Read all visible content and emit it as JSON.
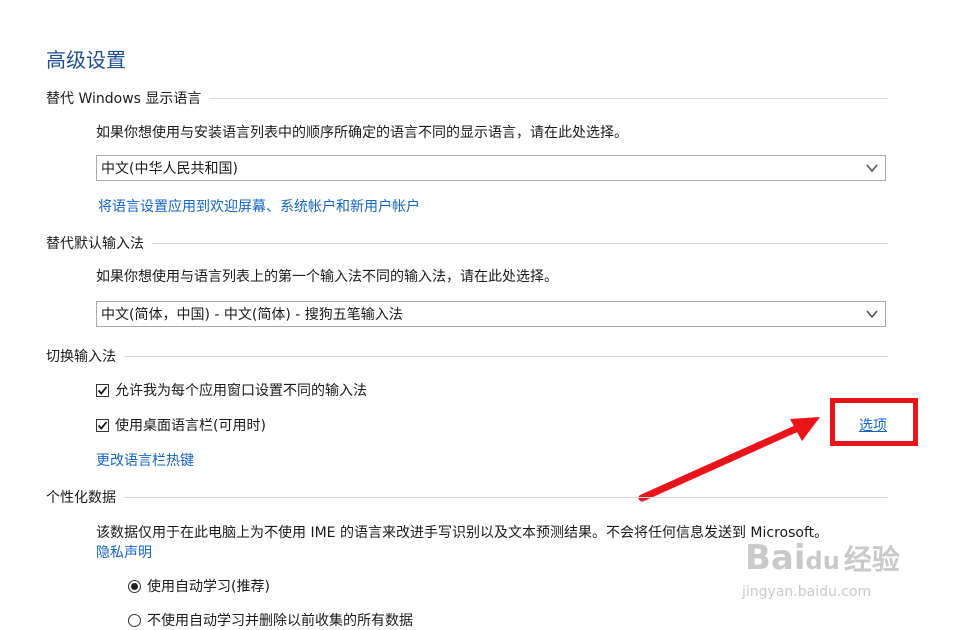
{
  "page": {
    "title": "高级设置"
  },
  "display_language": {
    "header": "替代 Windows 显示语言",
    "description": "如果你想使用与安装语言列表中的顺序所确定的语言不同的显示语言，请在此处选择。",
    "selected": "中文(中华人民共和国)",
    "apply_link": "将语言设置应用到欢迎屏幕、系统帐户和新用户帐户"
  },
  "input_method": {
    "header": "替代默认输入法",
    "description": "如果你想使用与语言列表上的第一个输入法不同的输入法，请在此处选择。",
    "selected": "中文(简体，中国) - 中文(简体) - 搜狗五笔输入法"
  },
  "switch_input": {
    "header": "切换输入法",
    "option1": {
      "label": "允许我为每个应用窗口设置不同的输入法",
      "checked": true
    },
    "option2": {
      "label": "使用桌面语言栏(可用时)",
      "checked": true
    },
    "options_link": "选项",
    "hotkey_link": "更改语言栏热键"
  },
  "personalization": {
    "header": "个性化数据",
    "description": "该数据仅用于在此电脑上为不使用 IME 的语言来改进手写识别以及文本预测结果。不会将任何信息发送到 Microsoft。",
    "privacy_link": "隐私声明",
    "radio1": {
      "label": "使用自动学习(推荐)",
      "selected": true
    },
    "radio2": {
      "label": "不使用自动学习并删除以前收集的所有数据",
      "selected": false
    }
  },
  "watermark": {
    "brand": "Bai",
    "brand_cn": "经验",
    "url": "jingyan.baidu.com"
  },
  "colors": {
    "accent": "#1e4e8c",
    "link": "#1565c0",
    "highlight": "#e8141a"
  }
}
